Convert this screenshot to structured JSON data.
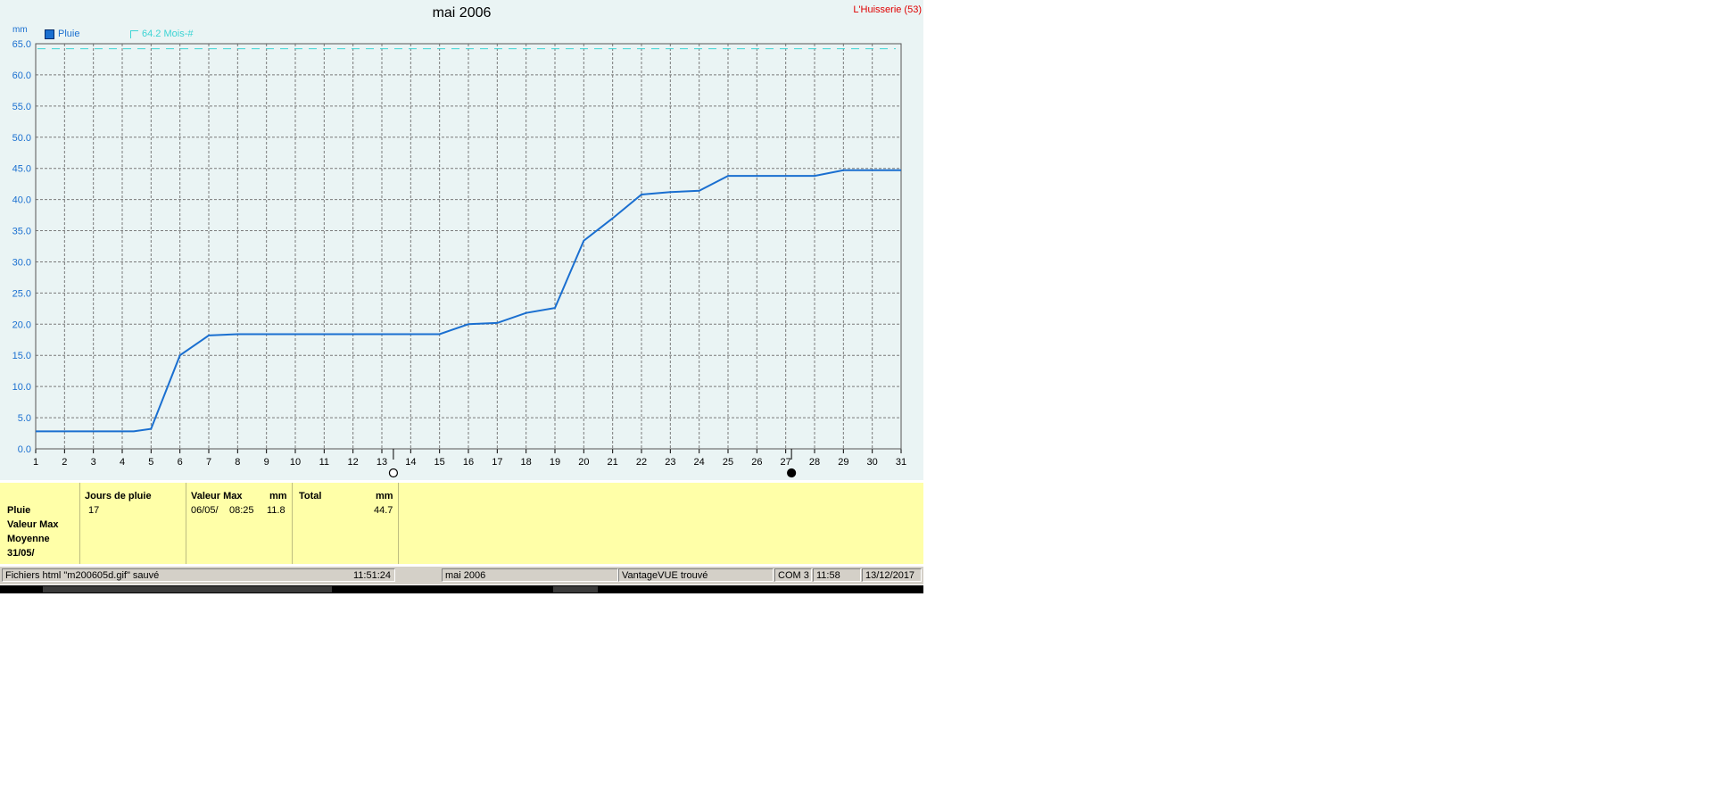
{
  "chart_data": {
    "type": "line",
    "title": "mai 2006",
    "station": "L'Huisserie (53)",
    "unit_label": "mm",
    "x": [
      1,
      2,
      3,
      4,
      5,
      6,
      7,
      8,
      9,
      10,
      11,
      12,
      13,
      14,
      15,
      16,
      17,
      18,
      19,
      20,
      21,
      22,
      23,
      24,
      25,
      26,
      27,
      28,
      29,
      30,
      31
    ],
    "xlim": [
      1,
      31
    ],
    "ylim": [
      0,
      65
    ],
    "yticks": [
      "0.0",
      "5.0",
      "10.0",
      "15.0",
      "20.0",
      "25.0",
      "30.0",
      "35.0",
      "40.0",
      "45.0",
      "50.0",
      "55.0",
      "60.0",
      "65.0"
    ],
    "grid": true,
    "legend_position": "top-left",
    "series": [
      {
        "name": "Pluie",
        "color": "#1a6fd0",
        "points": [
          [
            1,
            2.8
          ],
          [
            2,
            2.8
          ],
          [
            3,
            2.8
          ],
          [
            4,
            2.8
          ],
          [
            4.4,
            2.8
          ],
          [
            5,
            3.2
          ],
          [
            6,
            15.0
          ],
          [
            7,
            18.2
          ],
          [
            8,
            18.4
          ],
          [
            9,
            18.4
          ],
          [
            10,
            18.4
          ],
          [
            11,
            18.4
          ],
          [
            12,
            18.4
          ],
          [
            13,
            18.4
          ],
          [
            14,
            18.4
          ],
          [
            15,
            18.4
          ],
          [
            16,
            20.0
          ],
          [
            17,
            20.2
          ],
          [
            18,
            21.8
          ],
          [
            19,
            22.6
          ],
          [
            20,
            33.4
          ],
          [
            21,
            37.0
          ],
          [
            22,
            40.8
          ],
          [
            23,
            41.2
          ],
          [
            24,
            41.4
          ],
          [
            25,
            43.8
          ],
          [
            26,
            43.8
          ],
          [
            27,
            43.8
          ],
          [
            28,
            43.8
          ],
          [
            29,
            44.7
          ],
          [
            30,
            44.7
          ],
          [
            31,
            44.7
          ]
        ]
      },
      {
        "name": "64.2 Mois-#",
        "color": "#3cd4d4",
        "style": "dashed",
        "value": 64.2
      }
    ],
    "markers": [
      {
        "day": 13.4,
        "icon": "full-moon-icon"
      },
      {
        "day": 27.2,
        "icon": "new-moon-icon"
      }
    ]
  },
  "legend": {
    "pluie": "Pluie",
    "mois": "64.2 Mois-#",
    "pluie_color": "#1a6fd0",
    "mois_color": "#3cd4d4"
  },
  "stats": {
    "labels": [
      "Pluie",
      "Valeur Max",
      "Moyenne",
      "31/05/"
    ],
    "jours_header": "Jours de pluie",
    "jours_value": "17",
    "max_header": "Valeur Max",
    "max_unit": "mm",
    "max_date": "06/05/",
    "max_time": "08:25",
    "max_value": "11.8",
    "total_header": "Total",
    "total_unit": "mm",
    "total_value": "44.7"
  },
  "statusbar": {
    "file_msg": "Fichiers html  \"m200605d.gif\"  sauvé",
    "file_time": "11:51:24",
    "period": "mai 2006",
    "device": "VantageVUE trouvé",
    "port": "COM 3",
    "time": "11:58",
    "date": "13/12/2017"
  },
  "colors": {
    "background": "#eaf4f4",
    "stats_background": "#ffffa8",
    "axis": "#1a6fd0",
    "station": "#e00000"
  }
}
